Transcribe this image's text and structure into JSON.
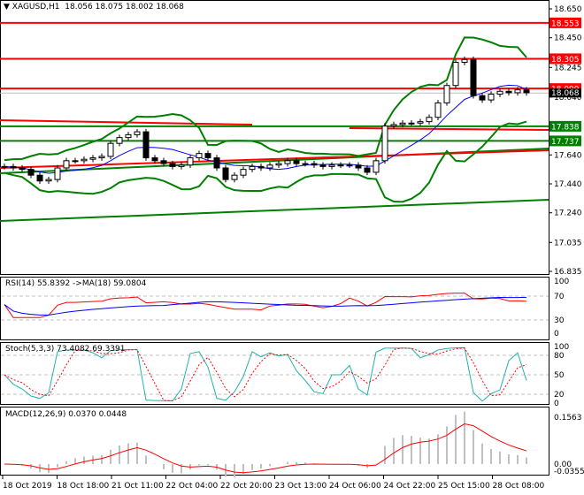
{
  "header": {
    "symbol": "XAGUSD,H1",
    "ohlc": "18.056 18.075 18.002 18.068"
  },
  "price_axis": [
    "18.650",
    "18.450",
    "18.245",
    "18.040",
    "17.640",
    "17.440",
    "17.240",
    "17.035",
    "16.835"
  ],
  "levels": [
    {
      "price": 18.553,
      "label": "18.553",
      "color": "#ff0000"
    },
    {
      "price": 18.305,
      "label": "18.305",
      "color": "#ff0000"
    },
    {
      "price": 18.099,
      "label": "18.099",
      "color": "#ff0000"
    },
    {
      "price": 17.838,
      "label": "17.838",
      "color": "#008000"
    },
    {
      "price": 17.737,
      "label": "17.737",
      "color": "#008000"
    }
  ],
  "current_price": "18.068",
  "rsi": {
    "title": "RSI(14) 55.8392  ->MA(18) 59.0804",
    "ticks": [
      "100",
      "70",
      "30",
      "0"
    ]
  },
  "stoch": {
    "title": "Stoch(5,3,3) 73.4082 69.3391",
    "ticks": [
      "100",
      "80",
      "50",
      "20",
      "0"
    ]
  },
  "macd": {
    "title": "MACD(12,26,9) 0.0370 0.0448",
    "ticks": [
      "0.1563",
      "0.00",
      "-0.0355"
    ]
  },
  "time_axis": [
    "18 Oct 2019",
    "18 Oct 18:00",
    "21 Oct 11:00",
    "22 Oct 04:00",
    "22 Oct 20:00",
    "23 Oct 13:00",
    "24 Oct 06:00",
    "24 Oct 22:00",
    "25 Oct 15:00",
    "28 Oct 08:00"
  ],
  "chart_data": {
    "type": "line",
    "title": "XAGUSD,H1",
    "ylim": [
      16.835,
      18.65
    ],
    "closes": [
      17.56,
      17.55,
      17.54,
      17.5,
      17.46,
      17.47,
      17.55,
      17.6,
      17.6,
      17.61,
      17.62,
      17.63,
      17.72,
      17.76,
      17.78,
      17.8,
      17.62,
      17.6,
      17.58,
      17.56,
      17.57,
      17.62,
      17.65,
      17.62,
      17.55,
      17.47,
      17.5,
      17.54,
      17.56,
      17.55,
      17.57,
      17.58,
      17.6,
      17.58,
      17.58,
      17.57,
      17.56,
      17.57,
      17.57,
      17.57,
      17.55,
      17.52,
      17.6,
      17.84,
      17.85,
      17.86,
      17.86,
      17.87,
      17.9,
      18.0,
      18.12,
      18.28,
      18.3,
      18.05,
      18.02,
      18.06,
      18.08,
      18.07,
      18.09,
      18.07
    ]
  }
}
